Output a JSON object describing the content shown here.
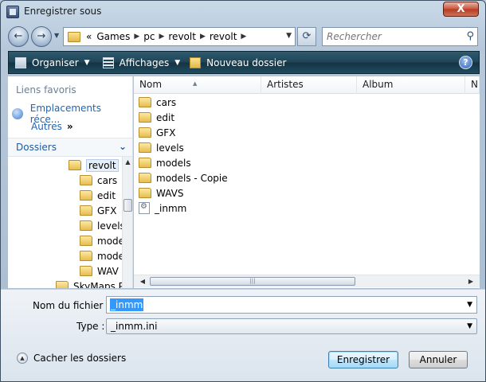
{
  "window": {
    "title": "Enregistrer sous",
    "close": "X"
  },
  "nav": {
    "back": "←",
    "forward": "→",
    "breadcrumb": {
      "overflow": "«",
      "segments": [
        "Games",
        "pc",
        "revolt",
        "revolt"
      ]
    },
    "refresh": "⟳",
    "search_placeholder": "Rechercher"
  },
  "toolbar": {
    "organize": "Organiser",
    "views": "Affichages",
    "new_folder": "Nouveau dossier",
    "help": "?"
  },
  "leftpane": {
    "favorites_title": "Liens favoris",
    "favorite_link": "Emplacements réce...",
    "others": "Autres",
    "folders_title": "Dossiers",
    "tree": [
      {
        "label": "revolt",
        "selected": true
      },
      {
        "label": "cars"
      },
      {
        "label": "edit"
      },
      {
        "label": "GFX"
      },
      {
        "label": "levels"
      },
      {
        "label": "mode"
      },
      {
        "label": "mode"
      },
      {
        "label": "WAV"
      },
      {
        "label": "SkyMaps P"
      }
    ]
  },
  "filelist": {
    "columns": [
      "Nom",
      "Artistes",
      "Album",
      "N°"
    ],
    "items": [
      {
        "name": "cars",
        "type": "folder"
      },
      {
        "name": "edit",
        "type": "folder"
      },
      {
        "name": "GFX",
        "type": "folder"
      },
      {
        "name": "levels",
        "type": "folder"
      },
      {
        "name": "models",
        "type": "folder"
      },
      {
        "name": "models - Copie",
        "type": "folder"
      },
      {
        "name": "WAVS",
        "type": "folder"
      },
      {
        "name": "_inmm",
        "type": "ini"
      }
    ]
  },
  "form": {
    "filename_label": "Nom du fichier :",
    "filename_value": "_inmm",
    "type_label": "Type :",
    "type_value": "_inmm.ini"
  },
  "footer": {
    "hide_folders": "Cacher les dossiers",
    "save": "Enregistrer",
    "cancel": "Annuler"
  }
}
